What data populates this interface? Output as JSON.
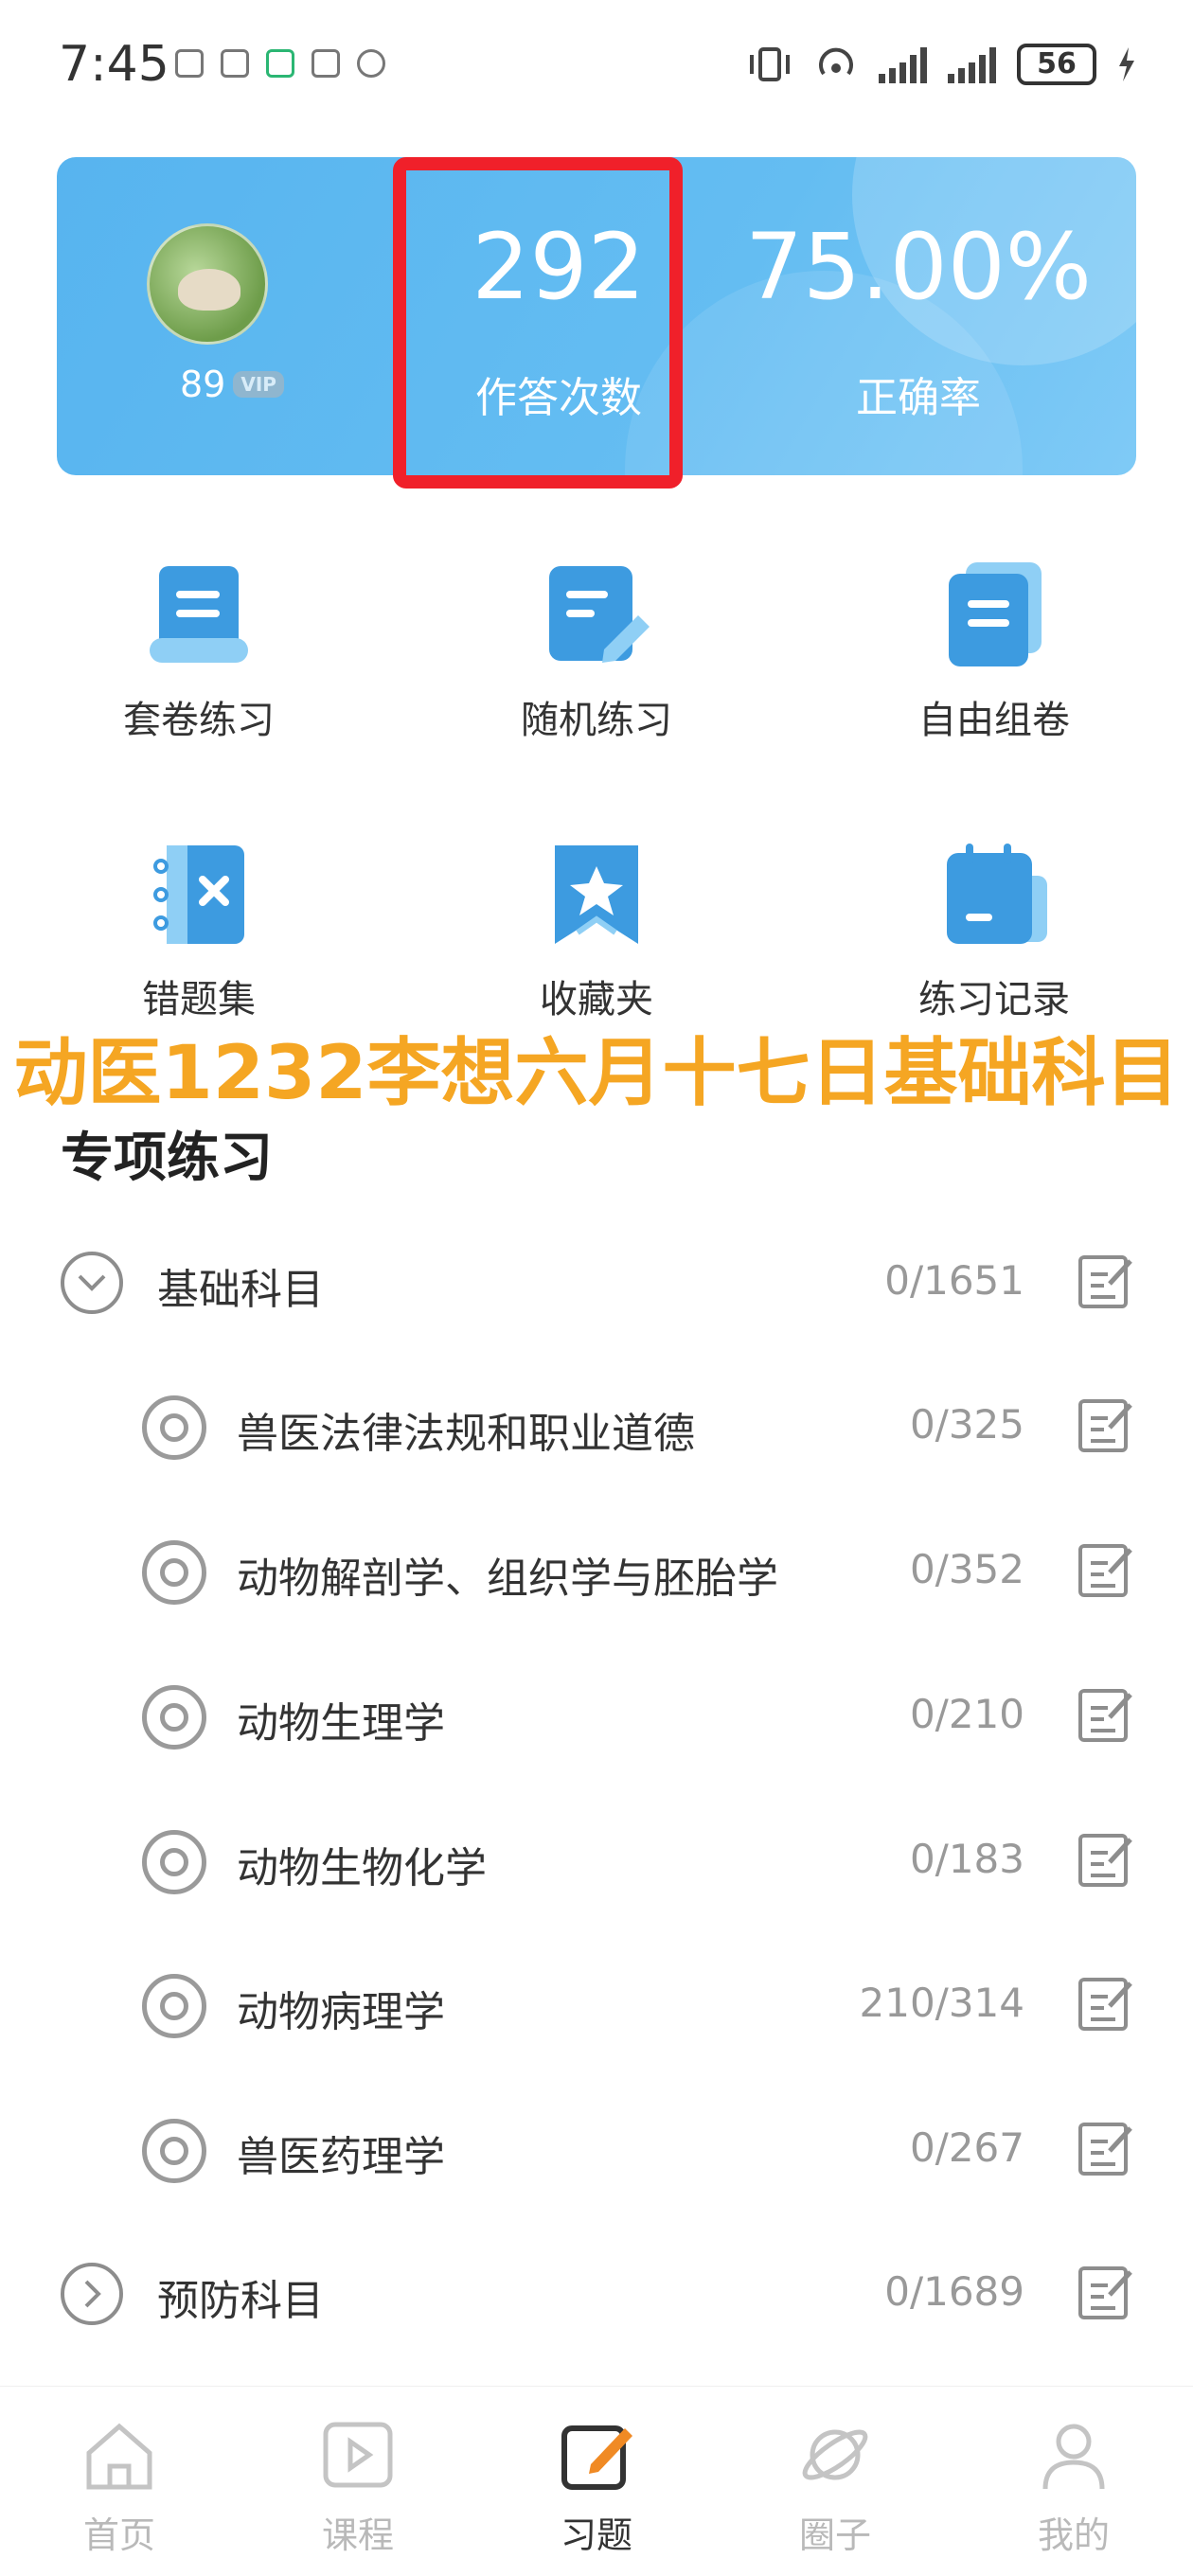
{
  "status_bar": {
    "time": "7:45",
    "battery": "56"
  },
  "header": {
    "level": "89",
    "vip_badge": "VIP",
    "answers_count": "292",
    "answers_label": "作答次数",
    "accuracy": "75.00%",
    "accuracy_label": "正确率"
  },
  "features": [
    {
      "label": "套卷练习",
      "icon": "scroll-doc-icon"
    },
    {
      "label": "随机练习",
      "icon": "doc-pencil-icon"
    },
    {
      "label": "自由组卷",
      "icon": "stacked-docs-icon"
    },
    {
      "label": "错题集",
      "icon": "notebook-x-icon"
    },
    {
      "label": "收藏夹",
      "icon": "bookmark-star-icon"
    },
    {
      "label": "练习记录",
      "icon": "calendar-record-icon"
    }
  ],
  "overlay_text": "动医1232李想六月十七日基础科目",
  "section_title": "专项练习",
  "categories": [
    {
      "label": "基础科目",
      "count": "0/1651",
      "expanded": true
    },
    {
      "label": "预防科目",
      "count": "0/1689",
      "expanded": false
    }
  ],
  "subjects": [
    {
      "label": "兽医法律法规和职业道德",
      "count": "0/325"
    },
    {
      "label": "动物解剖学、组织学与胚胎学",
      "count": "0/352"
    },
    {
      "label": "动物生理学",
      "count": "0/210"
    },
    {
      "label": "动物生物化学",
      "count": "0/183"
    },
    {
      "label": "动物病理学",
      "count": "210/314"
    },
    {
      "label": "兽医药理学",
      "count": "0/267"
    }
  ],
  "tabs": [
    {
      "label": "首页",
      "icon": "home-icon",
      "active": false
    },
    {
      "label": "课程",
      "icon": "play-icon",
      "active": false
    },
    {
      "label": "习题",
      "icon": "edit-icon",
      "active": true
    },
    {
      "label": "圈子",
      "icon": "planet-icon",
      "active": false
    },
    {
      "label": "我的",
      "icon": "user-icon",
      "active": false
    }
  ],
  "colors": {
    "accent": "#57b4ef",
    "highlight_border": "#f0202a",
    "overlay_text": "#f5a623",
    "active_tab_icon": "#f08a24"
  }
}
